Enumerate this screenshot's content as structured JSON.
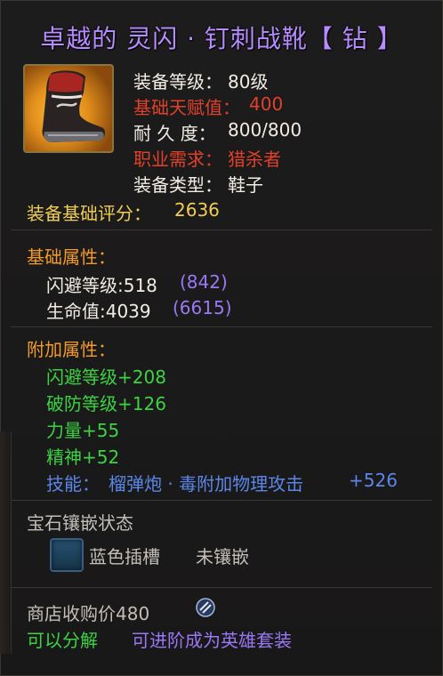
{
  "title": "卓越的 灵闪 · 钉刺战靴【 钻 】",
  "item": {
    "icon": "boot-icon",
    "level_label": "装备等级：",
    "level_value": "80级",
    "talent_label": "基础天赋值：",
    "talent_value": "400",
    "durability_label": "耐 久 度：",
    "durability_value": "800/800",
    "class_label": "职业需求：",
    "class_value": "猎杀者",
    "type_label": "装备类型：",
    "type_value": "鞋子"
  },
  "score": {
    "label": "装备基础评分：",
    "value": "2636"
  },
  "base_attrs": {
    "heading": "基础属性：",
    "rows": [
      {
        "name": "闪避等级:518",
        "bonus": "(842)"
      },
      {
        "name": "生命值:4039",
        "bonus": "(6615)"
      }
    ]
  },
  "extra_attrs": {
    "heading": "附加属性：",
    "rows": [
      "闪避等级+208",
      "破防等级+126",
      "力量+55",
      "精神+52"
    ],
    "skill_label": "技能：",
    "skill_text": "榴弹炮 · 毒附加物理攻击",
    "skill_value": "+526"
  },
  "gem": {
    "heading": "宝石镶嵌状态",
    "slot_label": "蓝色插槽",
    "slot_state": "未镶嵌"
  },
  "footer": {
    "sell_price": "商店收购价480",
    "decompose": "可以分解",
    "upgrade": "可进阶成为英雄套装"
  },
  "colors": {
    "title": "#b78cff",
    "white": "#f1ece4",
    "red": "#e2402a",
    "gold": "#f0cd55",
    "orange": "#f29a2c",
    "green": "#3dd243",
    "purple": "#9a78f4",
    "blue": "#5b86e8"
  }
}
